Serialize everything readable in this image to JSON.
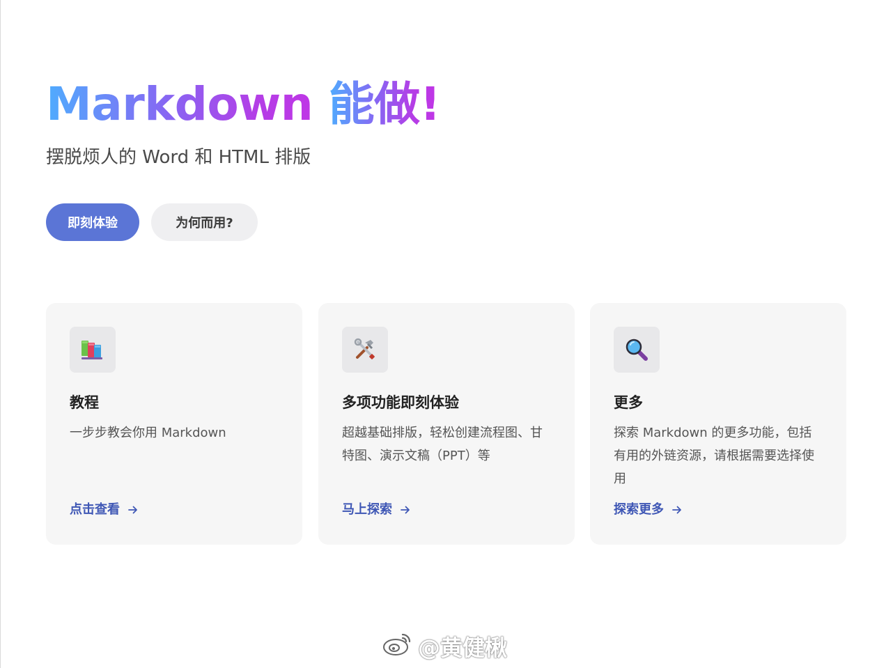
{
  "hero": {
    "title_latin": "Markdown ",
    "title_cjk": "能做!",
    "subtitle": "摆脱烦人的 Word 和 HTML 排版"
  },
  "actions": {
    "primary_label": "即刻体验",
    "secondary_label": "为何而用?"
  },
  "cards": [
    {
      "icon": "books-icon",
      "title": "教程",
      "description": "一步步教会你用 Markdown",
      "link_label": "点击查看"
    },
    {
      "icon": "tools-icon",
      "title": "多项功能即刻体验",
      "description": "超越基础排版，轻松创建流程图、甘特图、演示文稿（PPT）等",
      "link_label": "马上探索"
    },
    {
      "icon": "magnifier-icon",
      "title": "更多",
      "description": "探索 Markdown 的更多功能，包括有用的外链资源，请根据需要选择使用",
      "link_label": "探索更多"
    }
  ],
  "watermark": {
    "text": "@黄健楸"
  },
  "colors": {
    "primary": "#5b75d6",
    "link": "#3f57b5",
    "card_bg": "#f6f6f6",
    "gradient_start": "#4facfe",
    "gradient_end": "#c234e6"
  }
}
